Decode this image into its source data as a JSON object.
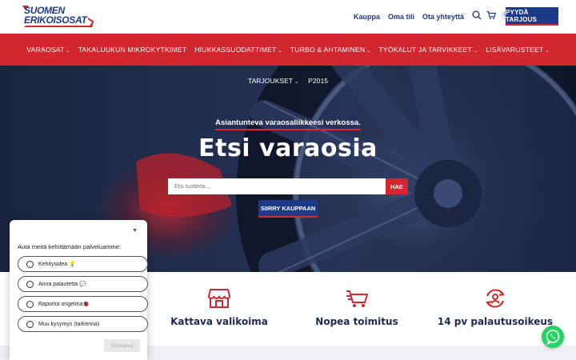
{
  "header": {
    "logo_line1": "SUOMEN",
    "logo_line2": "ERIKOISOSAT",
    "links": [
      "Kauppa",
      "Oma tili",
      "Ota yhteyttä"
    ],
    "cart_count": "0",
    "cta_label": "PYYDÄ TARJOUS"
  },
  "nav": {
    "items": [
      "VARAOSAT",
      "TAKALUUKUN MIKROKYTKIMET",
      "HIUKKASSUODATTIMET",
      "TURBO & AHTAMINEN",
      "TYÖKALUT JA TARVIKKEET",
      "LISÄVARUSTEET"
    ],
    "subitems": [
      "TARJOUKSET",
      "P2015"
    ]
  },
  "hero": {
    "tagline": "Asiantunteva varaosaliikkeesi verkossa.",
    "title": "Etsi varaosia",
    "search_placeholder": "Etsi tuotteita...",
    "search_button": "HAE",
    "shop_button": "SIIRRY KAUPPAAN"
  },
  "features": [
    {
      "label": "Kattava valikoima",
      "icon": "store-icon"
    },
    {
      "label": "Nopea toimitus",
      "icon": "delivery-truck-icon"
    },
    {
      "label": "14 pv palautusoikeus",
      "icon": "return-icon"
    }
  ],
  "survey": {
    "question": "Auta meitä kehittämään palveluamme:",
    "options": [
      "Kehitysidea 💡",
      "Anna palautetta 💬",
      "Raportoi ongelma🐞",
      "Muu kysymys (tarkenna)"
    ],
    "send_label": "Seuraava"
  },
  "colors": {
    "brand_blue": "#1d3a8a",
    "brand_red": "#d2272e",
    "whatsapp_green": "#25d366"
  }
}
